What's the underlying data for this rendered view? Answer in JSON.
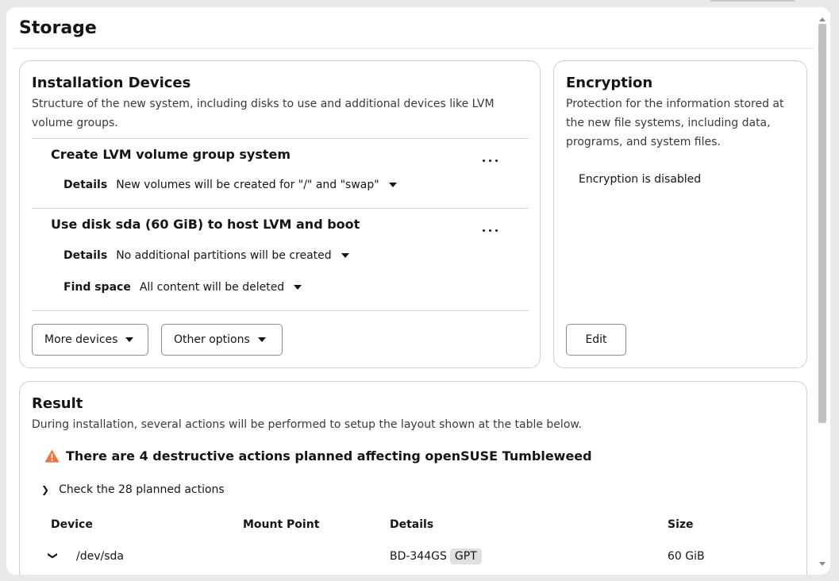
{
  "page": {
    "title": "Storage"
  },
  "installation_devices": {
    "title": "Installation Devices",
    "description": "Structure of the new system, including disks to use and additional devices like LVM volume groups.",
    "devices": [
      {
        "title": "Create LVM volume group system",
        "details_label": "Details",
        "details_value": "New volumes will be created for \"/\" and \"swap\""
      },
      {
        "title": "Use disk sda (60 GiB) to host LVM and boot",
        "details_label": "Details",
        "details_value": "No additional partitions will be created",
        "find_space_label": "Find space",
        "find_space_value": "All content will be deleted"
      }
    ],
    "more_devices_label": "More devices",
    "other_options_label": "Other options"
  },
  "encryption": {
    "title": "Encryption",
    "description": "Protection for the information stored at the new file systems, including data, programs, and system files.",
    "status": "Encryption is disabled",
    "edit_label": "Edit"
  },
  "result": {
    "title": "Result",
    "description": "During installation, several actions will be performed to setup the layout shown at the table below.",
    "warning": "There are 4 destructive actions planned affecting openSUSE Tumbleweed",
    "planned_actions_label": "Check the 28 planned actions",
    "table": {
      "headers": [
        "Device",
        "Mount Point",
        "Details",
        "Size"
      ],
      "rows": [
        {
          "device": "/dev/sda",
          "mount_point": "",
          "details": "BD-344GS",
          "badge": "GPT",
          "size": "60 GiB"
        }
      ]
    }
  },
  "colors": {
    "warning": "#f0723c",
    "badge_bg": "#e0e0e0",
    "border": "#cfcfcf"
  }
}
